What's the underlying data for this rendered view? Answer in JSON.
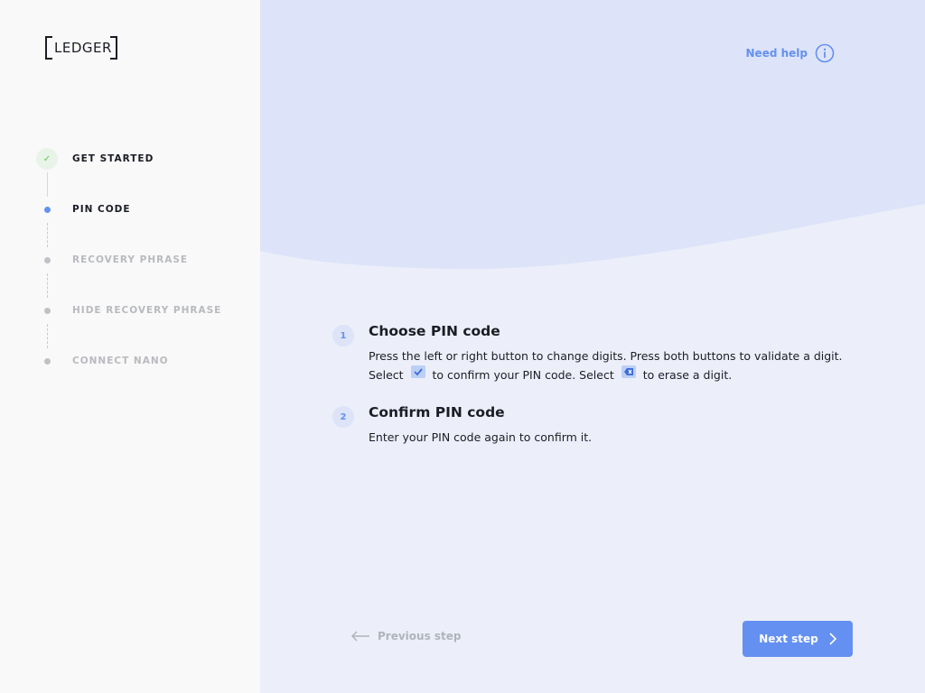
{
  "brand": {
    "logo_text": "LEDGER"
  },
  "sidebar": {
    "steps": [
      {
        "label": "GET STARTED",
        "state": "done"
      },
      {
        "label": "PIN CODE",
        "state": "active"
      },
      {
        "label": "RECOVERY PHRASE",
        "state": "pending"
      },
      {
        "label": "HIDE RECOVERY PHRASE",
        "state": "pending"
      },
      {
        "label": "CONNECT NANO",
        "state": "pending"
      }
    ]
  },
  "header": {
    "help_label": "Need help"
  },
  "instructions": [
    {
      "number": "1",
      "title": "Choose PIN code",
      "desc_line1": "Press the left or right button to change digits. Press both buttons to validate a digit.",
      "desc_select_a": "Select",
      "desc_confirm": "to confirm your PIN code. Select",
      "desc_erase": "to erase a digit."
    },
    {
      "number": "2",
      "title": "Confirm PIN code",
      "desc": "Enter your PIN code again to confirm it."
    }
  ],
  "footer": {
    "prev_label": "Previous step",
    "next_label": "Next step"
  },
  "colors": {
    "accent": "#6490f1",
    "success": "#66be54",
    "text": "#1b1d26"
  }
}
